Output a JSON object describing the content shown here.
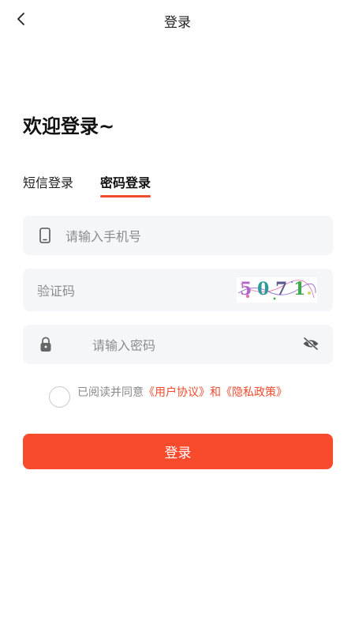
{
  "nav": {
    "title": "登录",
    "back_icon": "chevron-left-icon"
  },
  "welcome": "欢迎登录~",
  "tabs": [
    {
      "label": "短信登录",
      "active": false
    },
    {
      "label": "密码登录",
      "active": true
    }
  ],
  "phone": {
    "placeholder": "请输入手机号",
    "value": "",
    "icon": "phone-icon"
  },
  "code": {
    "placeholder": "验证码",
    "value": "",
    "captcha_text": "5071"
  },
  "password": {
    "placeholder": "请输入密码",
    "value": "",
    "icon": "lock-icon",
    "toggle_icon": "eye-off-icon"
  },
  "agreement": {
    "prefix": "已阅读并同意",
    "user_agreement": "《用户协议》",
    "and": "和",
    "privacy_policy": "《隐私政策》"
  },
  "login_button": "登录",
  "colors": {
    "accent": "#f84a2c",
    "link": "#f04b2f",
    "field_bg": "#f5f6f8"
  }
}
